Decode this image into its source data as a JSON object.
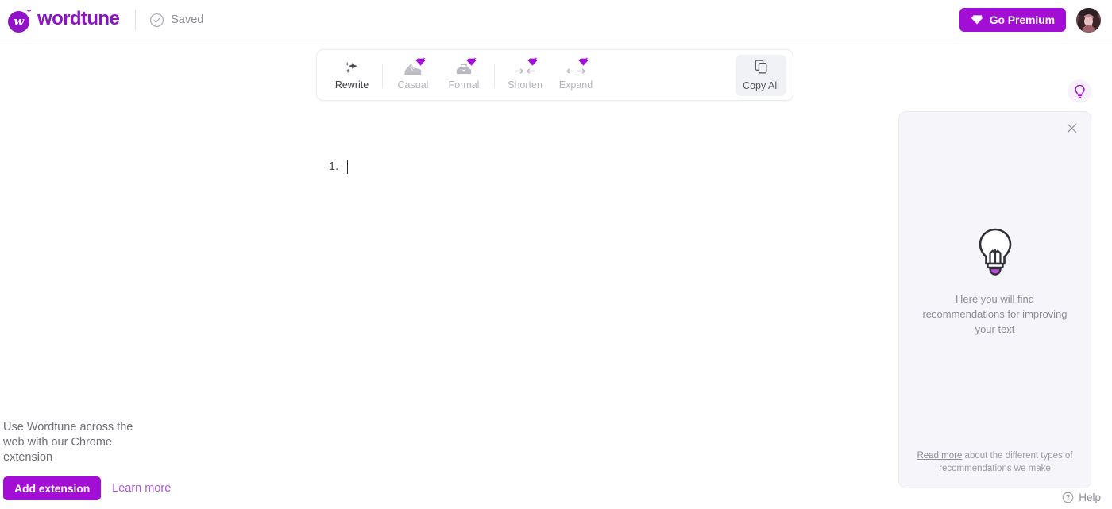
{
  "header": {
    "brand_name": "wordtune",
    "logo_letter": "w",
    "save_status": "Saved",
    "premium_label": "Go Premium"
  },
  "toolbar": {
    "tools": [
      {
        "label": "Rewrite",
        "icon": "sparkle-icon",
        "premium": false,
        "disabled": false
      },
      {
        "label": "Casual",
        "icon": "sneaker-icon",
        "premium": true,
        "disabled": true
      },
      {
        "label": "Formal",
        "icon": "briefcase-icon",
        "premium": true,
        "disabled": true
      },
      {
        "label": "Shorten",
        "icon": "arrows-inward-icon",
        "premium": true,
        "disabled": true
      },
      {
        "label": "Expand",
        "icon": "arrows-outward-icon",
        "premium": true,
        "disabled": true
      }
    ],
    "copy_all_label": "Copy All",
    "copy_all_icon": "copy-icon"
  },
  "editor": {
    "list_marker": "1."
  },
  "promo": {
    "text": "Use Wordtune across the web with our Chrome extension",
    "add_button": "Add extension",
    "learn_more": "Learn more"
  },
  "recommendations": {
    "close_icon": "close-icon",
    "bulb_icon": "lightbulb-icon",
    "empty_message": "Here you will find recommendations for improving your text",
    "footer_link": "Read more",
    "footer_rest": " about the different types of recommendations we make"
  },
  "fab": {
    "icon": "lightbulb-icon"
  },
  "help": {
    "label": "Help",
    "icon": "question-circle-icon"
  },
  "colors": {
    "brand_purple": "#8d13c6",
    "accent_purple": "#a30ed4",
    "gem_purple": "#a112d8",
    "panel_bg": "#f6f6fa",
    "muted_text": "#8d8d98"
  }
}
